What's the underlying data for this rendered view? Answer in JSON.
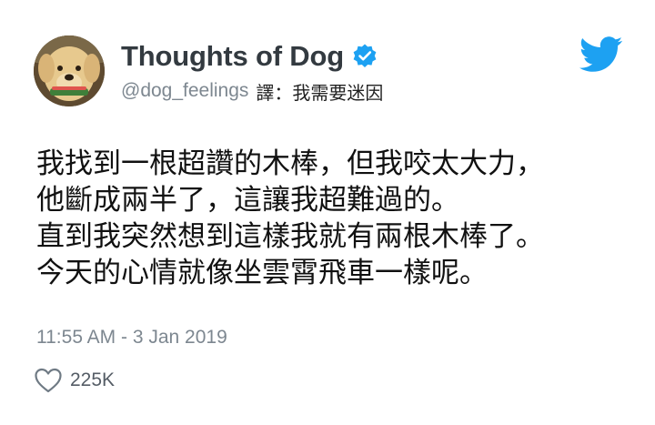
{
  "profile": {
    "display_name": "Thoughts of Dog",
    "handle": "@dog_feelings",
    "translation_note": "譯：我需要迷因",
    "avatar_icon": "dog-avatar",
    "verified_icon": "verified-badge-icon"
  },
  "brand": {
    "icon": "twitter-bird-icon",
    "color": "#1da1f2"
  },
  "tweet": {
    "lines": [
      "我找到一根超讚的木棒，但我咬太大力，",
      "他斷成兩半了，這讓我超難過的。",
      "直到我突然想到這樣我就有兩根木棒了。",
      "今天的心情就像坐雲霄飛車一樣呢。"
    ],
    "timestamp": "11:55 AM - 3 Jan 2019",
    "likes": "225K",
    "like_icon": "heart-outline-icon"
  }
}
